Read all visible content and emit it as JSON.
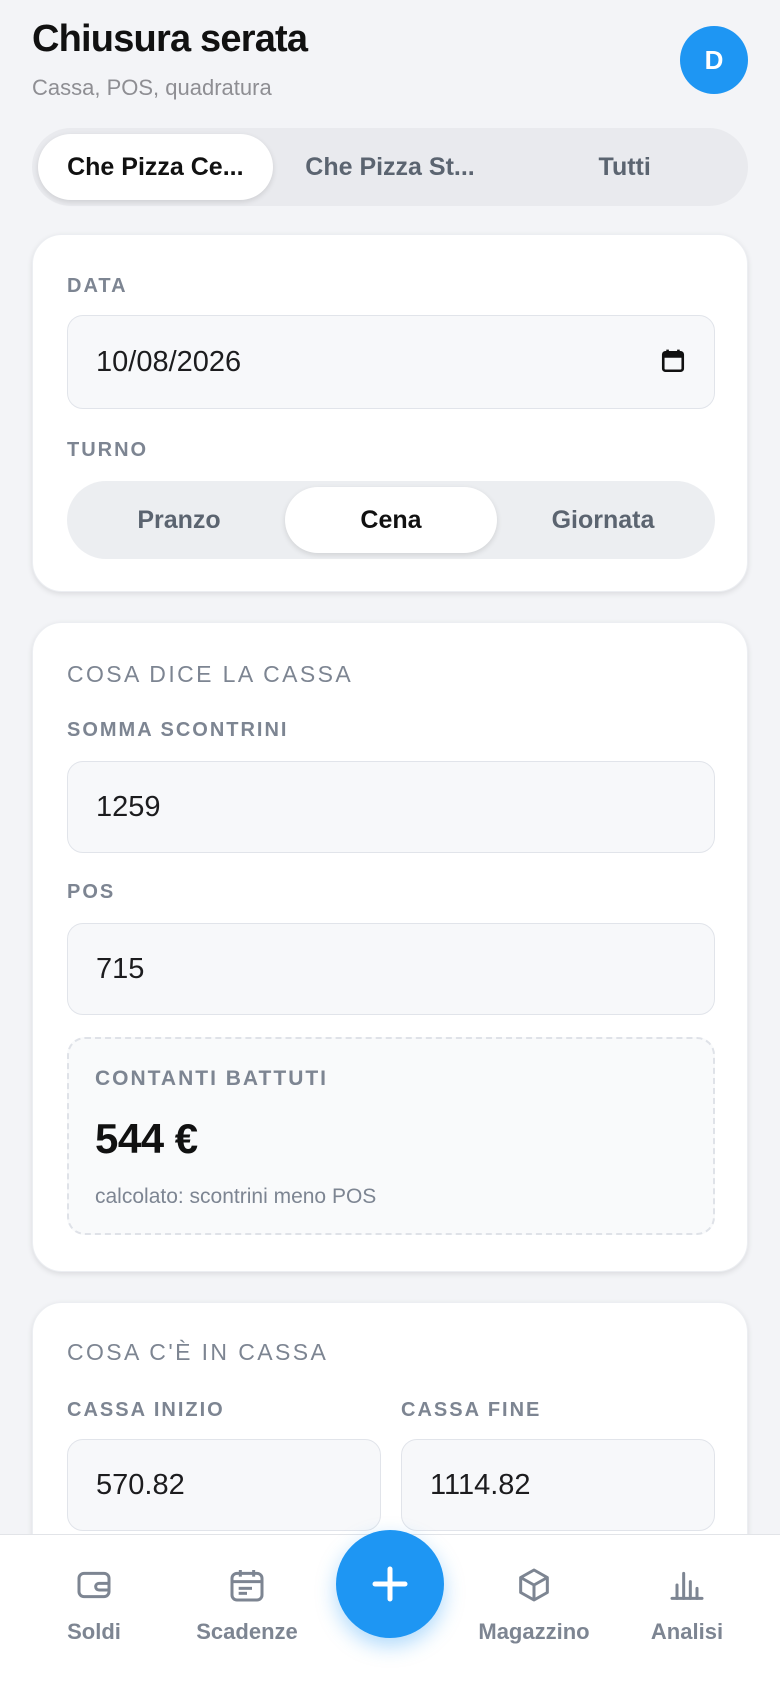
{
  "header": {
    "title": "Chiusura serata",
    "subtitle": "Cassa, POS, quadratura",
    "avatar_initial": "D"
  },
  "location_tabs": [
    {
      "label": "Che Pizza Ce...",
      "active": true
    },
    {
      "label": "Che Pizza St...",
      "active": false
    },
    {
      "label": "Tutti",
      "active": false
    }
  ],
  "date_card": {
    "date_label": "DATA",
    "date_value": "10/08/2026",
    "shift_label": "TURNO",
    "shifts": [
      {
        "label": "Pranzo",
        "active": false
      },
      {
        "label": "Cena",
        "active": true
      },
      {
        "label": "Giornata",
        "active": false
      }
    ]
  },
  "register_card": {
    "section_title": "COSA DICE LA CASSA",
    "receipts_label": "SOMMA SCONTRINI",
    "receipts_value": "1259",
    "pos_label": "POS",
    "pos_value": "715",
    "cash_label": "CONTANTI BATTUTI",
    "cash_value": "544 €",
    "cash_note": "calcolato: scontrini meno POS"
  },
  "drawer_card": {
    "section_title": "COSA C'È IN CASSA",
    "start_label": "CASSA INIZIO",
    "start_value": "570.82",
    "end_label": "CASSA FINE",
    "end_value": "1114.82"
  },
  "bottom_nav": {
    "items": [
      {
        "label": "Soldi",
        "icon": "wallet-icon"
      },
      {
        "label": "Scadenze",
        "icon": "calendar-icon"
      },
      {
        "label": "Magazzino",
        "icon": "box-icon"
      },
      {
        "label": "Analisi",
        "icon": "bar-chart-icon"
      }
    ],
    "fab_icon": "plus-icon"
  },
  "colors": {
    "accent": "#1e96f3",
    "background": "#f3f4f7",
    "muted_text": "#7d8592"
  }
}
